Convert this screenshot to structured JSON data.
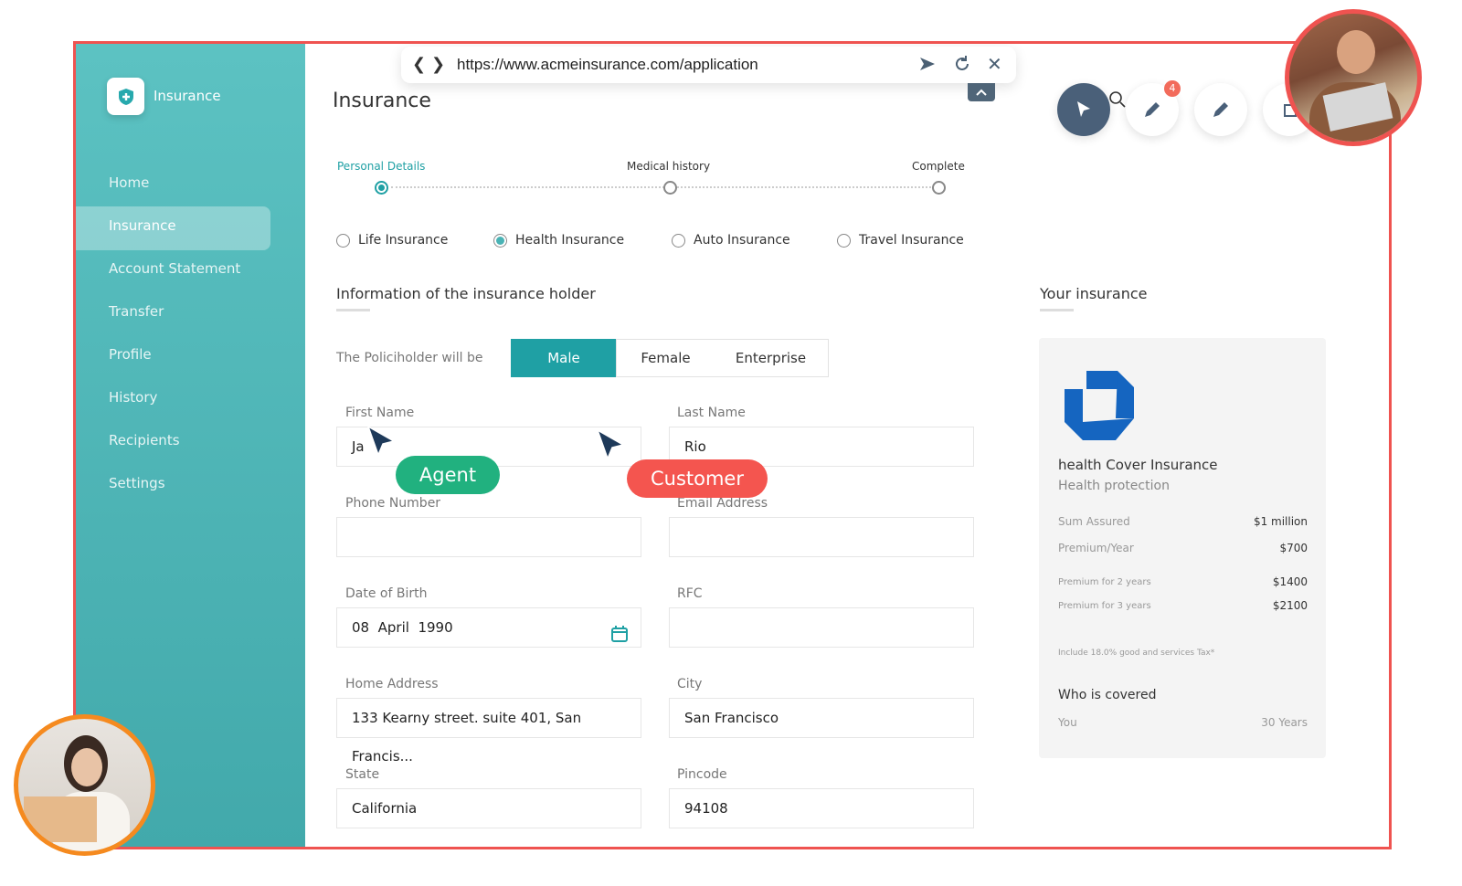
{
  "browser": {
    "url": "https://www.acmeinsurance.com/application"
  },
  "sidebar": {
    "brand": "Insurance",
    "items": [
      {
        "label": "Home"
      },
      {
        "label": "Insurance"
      },
      {
        "label": "Account Statement"
      },
      {
        "label": "Transfer"
      },
      {
        "label": "Profile"
      },
      {
        "label": "History"
      },
      {
        "label": "Recipients"
      },
      {
        "label": "Settings"
      }
    ],
    "active": "Insurance"
  },
  "main": {
    "title": "Insurance",
    "steps": [
      {
        "label": "Personal Details",
        "active": true
      },
      {
        "label": "Medical history",
        "active": false
      },
      {
        "label": "Complete",
        "active": false
      }
    ],
    "insurance_types": [
      {
        "label": "Life Insurance",
        "selected": false
      },
      {
        "label": "Health Insurance",
        "selected": true
      },
      {
        "label": "Auto Insurance",
        "selected": false
      },
      {
        "label": "Travel Insurance",
        "selected": false
      }
    ],
    "holder_section_title": "Information of the insurance holder",
    "policyholder_label": "The Policiholder will be",
    "policyholder_options": [
      {
        "label": "Male",
        "selected": true
      },
      {
        "label": "Female",
        "selected": false
      },
      {
        "label": "Enterprise",
        "selected": false
      }
    ],
    "fields": {
      "first_name": {
        "label": "First Name",
        "value": "Ja"
      },
      "last_name": {
        "label": "Last Name",
        "value": "Rio"
      },
      "phone": {
        "label": "Phone Number",
        "value": ""
      },
      "email": {
        "label": "Email Address",
        "value": ""
      },
      "dob": {
        "label": "Date of Birth",
        "value": "08  April  1990"
      },
      "rfc": {
        "label": "RFC",
        "value": ""
      },
      "address": {
        "label": "Home Address",
        "value": "133 Kearny street. suite 401, San Francis..."
      },
      "city": {
        "label": "City",
        "value": "San Francisco"
      },
      "state": {
        "label": "State",
        "value": "California"
      },
      "pincode": {
        "label": "Pincode",
        "value": "94108"
      }
    }
  },
  "your_insurance": {
    "title": "Your insurance",
    "plan_name": "health Cover Insurance",
    "plan_sub": "Health protection",
    "rows": [
      {
        "label": "Sum Assured",
        "value": "$1 million"
      },
      {
        "label": "Premium/Year",
        "value": "$700"
      },
      {
        "label": "Premium for 2 years",
        "value": "$1400"
      },
      {
        "label": "Premium for 3 years",
        "value": "$2100"
      }
    ],
    "tax_note": "Include 18.0% good and services Tax*",
    "covered_title": "Who is covered",
    "covered_who": "You",
    "covered_age": "30 Years"
  },
  "overlay": {
    "agent_label": "Agent",
    "customer_label": "Customer",
    "notification_count": "4",
    "agent_color": "#21b17f",
    "customer_color": "#f4554f",
    "frame_color": "#ef5350"
  },
  "colors": {
    "accent": "#1fa0a4",
    "sidebar": "#4ab3b5"
  }
}
